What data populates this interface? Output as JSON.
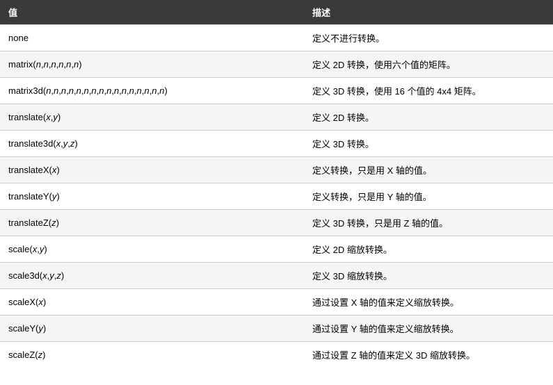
{
  "headers": {
    "value": "值",
    "description": "描述"
  },
  "rows": [
    {
      "value_parts": [
        [
          "none",
          0
        ]
      ],
      "desc": "定义不进行转换。"
    },
    {
      "value_parts": [
        [
          "matrix(",
          0
        ],
        [
          "n",
          1
        ],
        [
          ",",
          0
        ],
        [
          "n",
          1
        ],
        [
          ",",
          0
        ],
        [
          "n",
          1
        ],
        [
          ",",
          0
        ],
        [
          "n",
          1
        ],
        [
          ",",
          0
        ],
        [
          "n",
          1
        ],
        [
          ",",
          0
        ],
        [
          "n",
          1
        ],
        [
          ")",
          0
        ]
      ],
      "desc": "定义 2D 转换，使用六个值的矩阵。"
    },
    {
      "value_parts": [
        [
          "matrix3d(",
          0
        ],
        [
          "n",
          1
        ],
        [
          ",",
          0
        ],
        [
          "n",
          1
        ],
        [
          ",",
          0
        ],
        [
          "n",
          1
        ],
        [
          ",",
          0
        ],
        [
          "n",
          1
        ],
        [
          ",",
          0
        ],
        [
          "n",
          1
        ],
        [
          ",",
          0
        ],
        [
          "n",
          1
        ],
        [
          ",",
          0
        ],
        [
          "n",
          1
        ],
        [
          ",",
          0
        ],
        [
          "n",
          1
        ],
        [
          ",",
          0
        ],
        [
          "n",
          1
        ],
        [
          ",",
          0
        ],
        [
          "n",
          1
        ],
        [
          ",",
          0
        ],
        [
          "n",
          1
        ],
        [
          ",",
          0
        ],
        [
          "n",
          1
        ],
        [
          ",",
          0
        ],
        [
          "n",
          1
        ],
        [
          ",",
          0
        ],
        [
          "n",
          1
        ],
        [
          ",",
          0
        ],
        [
          "n",
          1
        ],
        [
          ",",
          0
        ],
        [
          "n",
          1
        ],
        [
          ")",
          0
        ]
      ],
      "desc": "定义 3D 转换，使用 16 个值的 4x4 矩阵。"
    },
    {
      "value_parts": [
        [
          "translate(",
          0
        ],
        [
          "x",
          1
        ],
        [
          ",",
          0
        ],
        [
          "y",
          1
        ],
        [
          ")",
          0
        ]
      ],
      "desc": "定义 2D 转换。"
    },
    {
      "value_parts": [
        [
          "translate3d(",
          0
        ],
        [
          "x",
          1
        ],
        [
          ",",
          0
        ],
        [
          "y",
          1
        ],
        [
          ",",
          0
        ],
        [
          "z",
          1
        ],
        [
          ")",
          0
        ]
      ],
      "desc": "定义 3D 转换。"
    },
    {
      "value_parts": [
        [
          "translateX(",
          0
        ],
        [
          "x",
          1
        ],
        [
          ")",
          0
        ]
      ],
      "desc": "定义转换，只是用 X 轴的值。"
    },
    {
      "value_parts": [
        [
          "translateY(",
          0
        ],
        [
          "y",
          1
        ],
        [
          ")",
          0
        ]
      ],
      "desc": "定义转换，只是用 Y 轴的值。"
    },
    {
      "value_parts": [
        [
          "translateZ(",
          0
        ],
        [
          "z",
          1
        ],
        [
          ")",
          0
        ]
      ],
      "desc": "定义 3D 转换，只是用 Z 轴的值。"
    },
    {
      "value_parts": [
        [
          "scale(",
          0
        ],
        [
          "x",
          1
        ],
        [
          ",",
          0
        ],
        [
          "y",
          1
        ],
        [
          ")",
          0
        ]
      ],
      "desc": "定义 2D 缩放转换。"
    },
    {
      "value_parts": [
        [
          "scale3d(",
          0
        ],
        [
          "x",
          1
        ],
        [
          ",",
          0
        ],
        [
          "y",
          1
        ],
        [
          ",",
          0
        ],
        [
          "z",
          1
        ],
        [
          ")",
          0
        ]
      ],
      "desc": "定义 3D 缩放转换。"
    },
    {
      "value_parts": [
        [
          "scaleX(",
          0
        ],
        [
          "x",
          1
        ],
        [
          ")",
          0
        ]
      ],
      "desc": "通过设置 X 轴的值来定义缩放转换。"
    },
    {
      "value_parts": [
        [
          "scaleY(",
          0
        ],
        [
          "y",
          1
        ],
        [
          ")",
          0
        ]
      ],
      "desc": "通过设置 Y 轴的值来定义缩放转换。"
    },
    {
      "value_parts": [
        [
          "scaleZ(",
          0
        ],
        [
          "z",
          1
        ],
        [
          ")",
          0
        ]
      ],
      "desc": "通过设置 Z 轴的值来定义 3D 缩放转换。"
    }
  ]
}
